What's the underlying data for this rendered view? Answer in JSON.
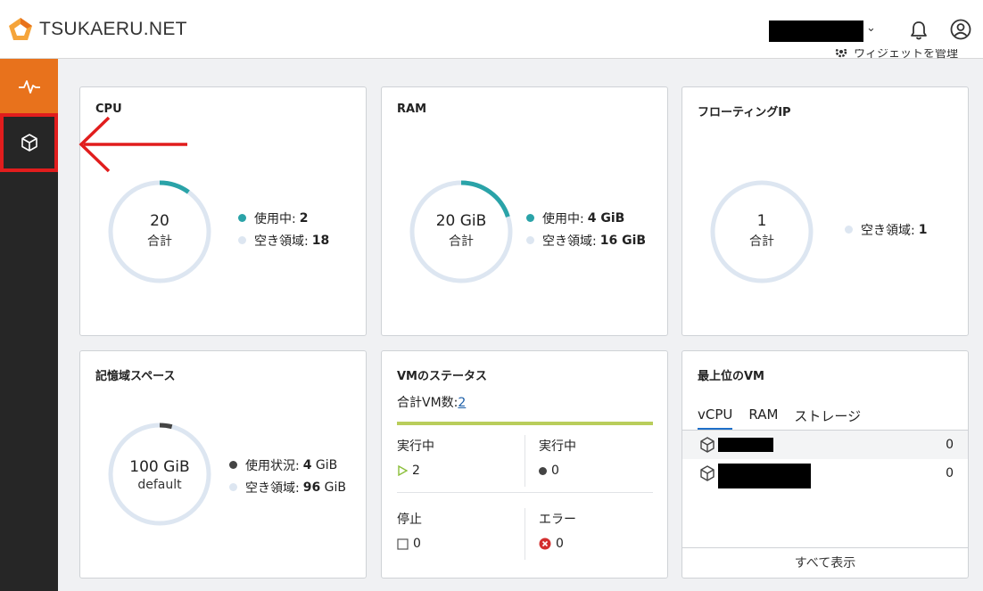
{
  "brand": {
    "name": "TSUKAERU.NET"
  },
  "header": {
    "manage_widgets": "ウィジェットを管理"
  },
  "cpu": {
    "title": "CPU",
    "total_value": "20",
    "total_label": "合計",
    "used_fraction": 0.1,
    "legend": [
      {
        "label": "使用中:",
        "value": "2",
        "color": "#2aa3a8"
      },
      {
        "label": "空き領域:",
        "value": "18",
        "color": "#dde6f1"
      }
    ]
  },
  "ram": {
    "title": "RAM",
    "total_value": "20 GiB",
    "total_label": "合計",
    "used_fraction": 0.2,
    "legend": [
      {
        "label": "使用中:",
        "value": "4 GiB",
        "color": "#2aa3a8"
      },
      {
        "label": "空き領域:",
        "value": "16 GiB",
        "color": "#dde6f1"
      }
    ]
  },
  "floating_ip": {
    "title": "フローティングIP",
    "total_value": "1",
    "total_label": "合計",
    "used_fraction": 0,
    "legend": [
      {
        "label": "空き領域:",
        "value": "1",
        "color": "#dde6f1"
      }
    ]
  },
  "storage": {
    "title": "記憶域スペース",
    "total_value": "100 GiB",
    "total_label": "default",
    "used_fraction": 0.04,
    "legend": [
      {
        "label": "使用状況:",
        "value": "4",
        "unit": "GiB",
        "color": "#444444"
      },
      {
        "label": "空き領域:",
        "value": "96",
        "unit": "GiB",
        "color": "#dde6f1"
      }
    ]
  },
  "vm_status": {
    "title": "VMのステータス",
    "total_label": "合計VM数:",
    "total_count": "2",
    "running": {
      "label": "実行中",
      "value": "2"
    },
    "running2": {
      "label": "実行中",
      "value": "0"
    },
    "stopped": {
      "label": "停止",
      "value": "0"
    },
    "error": {
      "label": "エラー",
      "value": "0"
    }
  },
  "top_vm": {
    "title": "最上位のVM",
    "tabs": [
      "vCPU",
      "RAM",
      "ストレージ"
    ],
    "rows": [
      {
        "value": "0"
      },
      {
        "value": "0"
      }
    ],
    "show_all": "すべて表示"
  },
  "colors": {
    "accent_orange": "#e8721c",
    "teal": "#2aa3a8",
    "ring": "#dde6f1",
    "highlight_red": "#e11d1d",
    "vm_bar": "#b9cd5b"
  }
}
